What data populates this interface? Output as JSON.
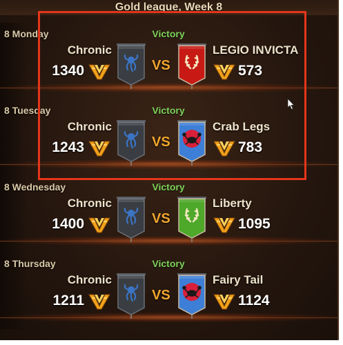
{
  "header": {
    "title": "Gold league, Week 8"
  },
  "player_team": "Chronic",
  "matches": [
    {
      "day": "8 Monday",
      "result": "Victory",
      "left_name": "Chronic",
      "left_score": "1340",
      "right_name": "LEGIO INVICTA",
      "right_score": "573",
      "right_banner_color": "#c81a14",
      "right_emblem": "laurel-wreath-icon"
    },
    {
      "day": "8 Tuesday",
      "result": "Victory",
      "left_name": "Chronic",
      "left_score": "1243",
      "right_name": "Crab Legs",
      "right_score": "783",
      "right_banner_color": "#3d7fd6",
      "right_emblem": "crab-icon"
    },
    {
      "day": "8 Wednesday",
      "result": "Victory",
      "left_name": "Chronic",
      "left_score": "1400",
      "right_name": "Liberty",
      "right_score": "1095",
      "right_banner_color": "#4ea82a",
      "right_emblem": "laurel-wreath-icon"
    },
    {
      "day": "8 Thursday",
      "result": "Victory",
      "left_name": "Chronic",
      "left_score": "1211",
      "right_name": "Fairy Tail",
      "right_score": "1124",
      "right_banner_color": "#3d7fd6",
      "right_emblem": "crab-icon"
    }
  ],
  "vs_label": "VS",
  "colors": {
    "victory": "#7fd35a",
    "vs": "#f0a52c",
    "highlight_box": "#e5361b",
    "left_banner": "#3a3d42",
    "left_emblem": "#3b74c4"
  }
}
